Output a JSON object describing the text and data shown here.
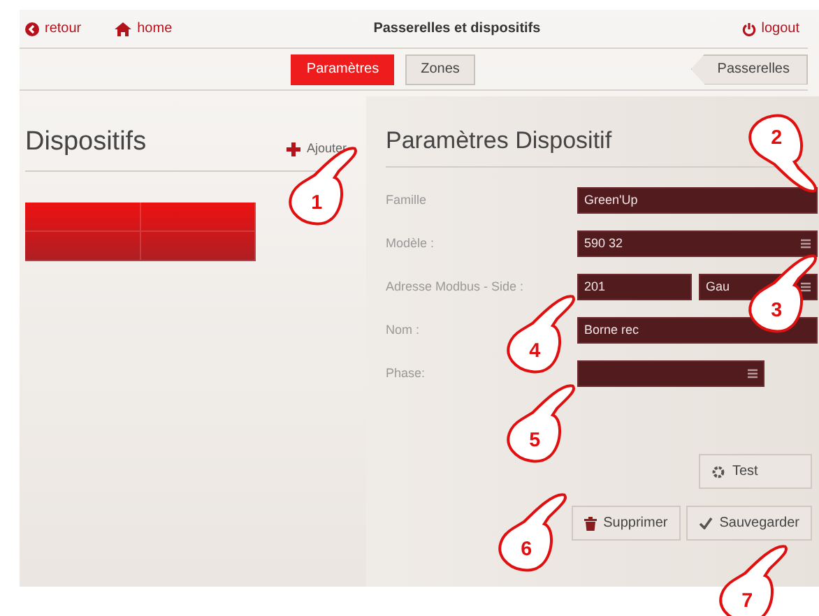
{
  "header": {
    "back": "retour",
    "home": "home",
    "title": "Passerelles et dispositifs",
    "logout": "logout"
  },
  "tabs": [
    {
      "label": "Paramètres",
      "selected": true
    },
    {
      "label": "Zones",
      "selected": false
    }
  ],
  "gateways_button": "Passerelles",
  "devices": {
    "title": "Dispositifs",
    "add": "Ajouter"
  },
  "form": {
    "title": "Paramètres Dispositif",
    "fields": [
      {
        "label": "Famille",
        "kind": "text",
        "value": "Green'Up"
      },
      {
        "label": "Modèle :",
        "kind": "select",
        "value": "590 32"
      },
      {
        "label": "Adresse Modbus - Side :",
        "kind": "pair",
        "value": "201",
        "value_2": "Gau"
      },
      {
        "label": "Nom :",
        "kind": "text",
        "value": "Borne rec"
      },
      {
        "label": "Phase:",
        "kind": "short-select"
      }
    ]
  },
  "buttons": {
    "test": "Test",
    "delete": "Supprimer",
    "save": "Sauvegarder"
  },
  "callouts": [
    "1",
    "2",
    "3",
    "4",
    "5",
    "6",
    "7"
  ]
}
